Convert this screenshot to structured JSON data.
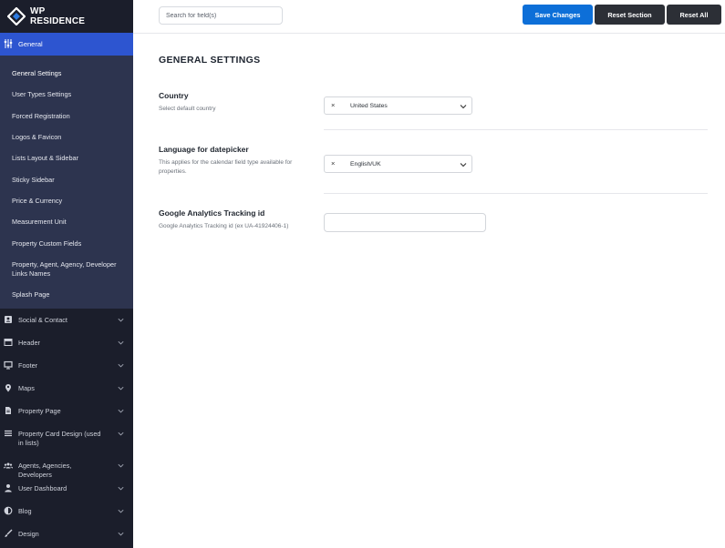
{
  "brand": {
    "line1": "WP",
    "line2": "RESIDENCE"
  },
  "sidebar": {
    "active_section": {
      "label": "General",
      "icon": "sliders-icon"
    },
    "sub_items": [
      {
        "label": "General Settings",
        "active": true
      },
      {
        "label": "User Types Settings"
      },
      {
        "label": "Forced Registration"
      },
      {
        "label": "Logos & Favicon"
      },
      {
        "label": "Lists Layout & Sidebar"
      },
      {
        "label": "Sticky Sidebar"
      },
      {
        "label": "Price & Currency"
      },
      {
        "label": "Measurement Unit"
      },
      {
        "label": "Property Custom Fields"
      },
      {
        "label": "Property, Agent, Agency, Developer Links Names"
      },
      {
        "label": "Splash Page"
      }
    ],
    "sections": [
      {
        "label": "Social & Contact",
        "icon": "contact-card-icon"
      },
      {
        "label": "Header",
        "icon": "header-icon"
      },
      {
        "label": "Footer",
        "icon": "monitor-icon"
      },
      {
        "label": "Maps",
        "icon": "map-pin-icon"
      },
      {
        "label": "Property Page",
        "icon": "document-icon"
      },
      {
        "label": "Property Card Design (used in lists)",
        "icon": "list-icon"
      },
      {
        "label": "Agents, Agencies, Developers",
        "icon": "users-icon"
      },
      {
        "label": "User Dashboard",
        "icon": "user-icon"
      },
      {
        "label": "Blog",
        "icon": "half-circle-icon"
      },
      {
        "label": "Design",
        "icon": "brush-icon"
      }
    ]
  },
  "toolbar": {
    "search_placeholder": "Search for field(s)",
    "save_label": "Save Changes",
    "reset_section_label": "Reset Section",
    "reset_all_label": "Reset All"
  },
  "main": {
    "title": "GENERAL SETTINGS",
    "fields": [
      {
        "title": "Country",
        "description": "Select default country",
        "value": "United States"
      },
      {
        "title": "Language for datepicker",
        "description": "This applies for the calendar field type available for properties.",
        "value": "English/UK"
      },
      {
        "title": "Google Analytics Tracking id",
        "description": "Google Analytics Tracking id (ex UA-41924406-1)",
        "value": ""
      }
    ],
    "clear_symbol": "×"
  },
  "colors": {
    "sidebar_bg": "#1b1e2b",
    "subnav_bg": "#2d344f",
    "active_bg": "#2d55d0",
    "save_button": "#0d6fd8",
    "dark_button": "#2c2f36"
  }
}
